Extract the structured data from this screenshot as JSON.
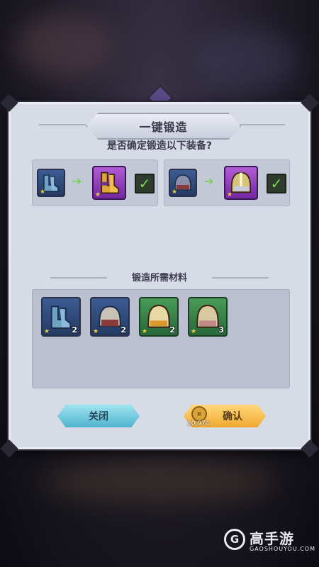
{
  "dialog": {
    "title": "一键锻造",
    "question": "是否确定锻造以下装备?"
  },
  "upgrades": [
    {
      "from": {
        "item": "boots",
        "rarity": "blue"
      },
      "to": {
        "item": "boots",
        "rarity": "purple"
      },
      "checked": true
    },
    {
      "from": {
        "item": "helmet",
        "rarity": "blue"
      },
      "to": {
        "item": "helmet",
        "rarity": "purple"
      },
      "checked": true
    }
  ],
  "materials": {
    "title": "锻造所需材料",
    "items": [
      {
        "item": "boots",
        "rarity": "blue",
        "count": "2"
      },
      {
        "item": "helmet",
        "rarity": "blue",
        "count": "2"
      },
      {
        "item": "helmet",
        "rarity": "green",
        "count": "2"
      },
      {
        "item": "helmet",
        "rarity": "green",
        "count": "3"
      }
    ]
  },
  "buttons": {
    "close": "关闭",
    "confirm": "确认",
    "cost": "20,974"
  },
  "watermark": {
    "brand": "高手游",
    "url": "GAOSHOUYOU.COM"
  },
  "colors": {
    "blue": "#3c5c93",
    "purple": "#9a45c0",
    "green": "#3f8a4c",
    "check": "#6ee04a"
  }
}
